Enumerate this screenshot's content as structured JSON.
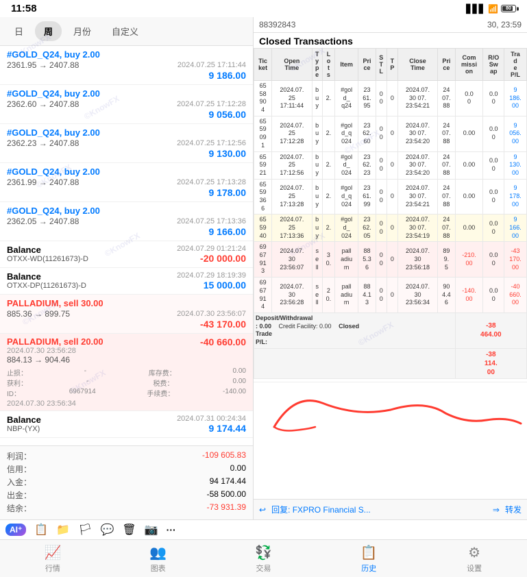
{
  "statusBar": {
    "time": "11:58",
    "battery": "80"
  },
  "leftPanel": {
    "tabs": [
      {
        "label": "日",
        "active": false
      },
      {
        "label": "周",
        "active": true
      },
      {
        "label": "月份",
        "active": false
      },
      {
        "label": "自定义",
        "active": false
      }
    ],
    "transactions": [
      {
        "id": "tx1",
        "title": "#GOLD_Q24, buy 2.00",
        "titleType": "buy",
        "date": "2024.07.25 17:11:44",
        "priceChange": "2361.95 → 2407.88",
        "amount": "9 186.00",
        "negative": false
      },
      {
        "id": "tx2",
        "title": "#GOLD_Q24, buy 2.00",
        "titleType": "buy",
        "date": "2024.07.25 17:12:28",
        "priceChange": "2362.60 → 2407.88",
        "amount": "9 056.00",
        "negative": false
      },
      {
        "id": "tx3",
        "title": "#GOLD_Q24, buy 2.00",
        "titleType": "buy",
        "date": "2024.07.25 17:12:56",
        "priceChange": "2362.23 → 2407.88",
        "amount": "9 130.00",
        "negative": false
      },
      {
        "id": "tx4",
        "title": "#GOLD_Q24, buy 2.00",
        "titleType": "buy",
        "date": "2024.07.25 17:13:28",
        "priceChange": "2361.99 → 2407.88",
        "amount": "9 178.00",
        "negative": false
      },
      {
        "id": "tx5",
        "title": "#GOLD_Q24, buy 2.00",
        "titleType": "buy",
        "date": "2024.07.25 17:13:36",
        "priceChange": "2362.05 → 2407.88",
        "amount": "9 166.00",
        "negative": false
      },
      {
        "id": "tx6",
        "title": "Balance",
        "titleType": "balance",
        "sub": "OTXX-WD(11261673)-D",
        "date": "2024.07.29 01:21:24",
        "amount": "-20 000.00",
        "negative": true
      },
      {
        "id": "tx7",
        "title": "Balance",
        "titleType": "balance",
        "sub": "OTXX-DP(11261673)-D",
        "date": "2024.07.29 18:19:39",
        "amount": "15 000.00",
        "negative": false,
        "blue": true
      },
      {
        "id": "tx8",
        "title": "PALLADIUM, sell 30.00",
        "titleType": "sell",
        "date": "2024.07.30 23:56:07",
        "priceChange": "885.36 → 899.75",
        "amount": "-43 170.00",
        "negative": true
      },
      {
        "id": "tx9",
        "title": "PALLADIUM, sell 20.00",
        "titleType": "sell",
        "date": "2024.07.30 23:56:28",
        "priceChange": "884.13 → 904.46",
        "amount": "-40 660.00",
        "negative": true,
        "sub2": "2024.07.30 23:56:34"
      }
    ],
    "palladiumDetails": {
      "stopLoss": "-",
      "stockFee": "0.00",
      "profit": "-",
      "tax": "0.00",
      "id": "6967914",
      "continueFee": "-140.00"
    },
    "balanceNBP": {
      "title": "Balance",
      "sub": "NBP-(YX)",
      "date": "2024.07.31 00:24:34",
      "amount": "9 174.44"
    },
    "stats": {
      "profit_label": "利润：",
      "profit_val": "-109 605.83",
      "credit_label": "信用：",
      "credit_val": "0.00",
      "deposit_label": "入金：",
      "deposit_val": "94 174.44",
      "withdraw_label": "出金：",
      "withdraw_val": "-58 500.00",
      "balance_label": "结余：",
      "balance_val": "-73 931.39"
    }
  },
  "rightPanel": {
    "header": "88392843                          30, 23:59",
    "title": "Closed Transactions",
    "tableHeaders": [
      "Tic\nket",
      "Open\nTime",
      "T\ny\np\ne",
      "L\no\nt\ns",
      "Item",
      "Pri\nce",
      "S\nT\nL",
      "T\nP",
      "Close\nTime",
      "Pri\nce",
      "Com\nmissi\non",
      "R/O\nSw\nap",
      "Tra\nd\ne\nP/L"
    ],
    "tableRows": [
      [
        "65\n58\n90\n4",
        "2024.07.\n25\n17:11:44",
        "b\nu\ny",
        "2.",
        "#gol\nd_\nq24",
        "23\n61.\n95\n0",
        "0\n0\n0",
        "0",
        "2024.07.\n30 07.\n23:54:21",
        "24\n07.\n88",
        "0.0\n0",
        "0.0\n0",
        "9\n186.\n00"
      ],
      [
        "65\n59\n09\n1",
        "2024.07.\n25\n17:12:28",
        "b\nu\ny",
        "2.",
        "#gol\nd_q\n024",
        "23\n62.\n60\n0",
        "0\n0\n0",
        "0",
        "2024.07.\n30 07.\n23:54:20",
        "24\n07.\n88",
        "0.00",
        "0.0\n0",
        "9\n056.\n00"
      ],
      [
        "65\n59\n21",
        "2024.07.\n25\n17:12:56",
        "b\nu\ny",
        "2.",
        "#gol\nd_\n024",
        "23\n62.\n23",
        "0\n0\n0",
        "0",
        "2024.07.\n30 07.\n23:54:20",
        "24\n07.\n88",
        "0.00",
        "0.0\n0",
        "9\n130.\n00"
      ],
      [
        "65\n59\n36\n6",
        "2024.07.\n25\n17:13:28",
        "b\nu\ny",
        "2.",
        "#gol\nd_q\n024",
        "23\n61.\n99",
        "0\n0\n0",
        "0",
        "2024.07.\n30 07.\n23:54:21",
        "24\n07.\n88",
        "0.00",
        "0.0\n0",
        "9\n178.\n00"
      ],
      [
        "65\n59\n40",
        "2024.07.\n25\n17:13:36",
        "b\nu\ny",
        "2.",
        "#gol\nd_\n024",
        "23\n62.\n05",
        "0\n0\n0",
        "0",
        "2024.07.\n30 07.\n23:54:19",
        "24\n07.\n88\n0",
        "0.00",
        "0.0\n0",
        "9\n166.\n00"
      ],
      [
        "69\n67\n91\n3",
        "2024.07.\n30\n23:56:07",
        "s\ne\nll",
        "3\n0.",
        "pall\nadiu\nm",
        "88\n5.3\n6\n0\n0",
        "0\n0\n0",
        "0\n0",
        "2024.07.\n30 9.7\n23:56:18",
        "89\n9.\n5",
        "-210.\n00",
        "0.0\n0",
        "-43\n170.\n00"
      ],
      [
        "69\n67\n91\n4",
        "2024.07.\n30\n23:56:28",
        "s\ne\nll",
        "2\n0.",
        "pall\nadiu\nm",
        "88\n4.1\n3\n0\n0",
        "0\n0\n0",
        "0\n0",
        "2024.07.\n30\n23:56:34",
        "90\n4.4\n6",
        "-140.\n00",
        "0.0\n0",
        "-40\n660.\n00"
      ]
    ],
    "bottomRow": {
      "depositLabel": "Deposit/Withdrawal\n: 0.00",
      "creditLabel": "Credit Facility: 0.00",
      "closedLabel": "Closed\nTrade\nP/L:",
      "closedVal": "-38\n464.00"
    },
    "lastRow": [
      "-38\n114.\n00"
    ],
    "replyBar": {
      "replyIcon": "↩",
      "replyText": "回复: FXPRO Financial S...",
      "forwardIcon": "⇒",
      "forwardText": "转发"
    }
  },
  "aiToolbar": {
    "aiLabel": "AI⁺",
    "icons": [
      "📋",
      "🏳",
      "💬",
      "🗑",
      "📷",
      "···"
    ]
  },
  "bottomNav": {
    "items": [
      {
        "icon": "📈",
        "label": "行情",
        "active": false
      },
      {
        "icon": "👥",
        "label": "图表",
        "active": false
      },
      {
        "icon": "💱",
        "label": "交易",
        "active": false
      },
      {
        "icon": "📋",
        "label": "历史",
        "active": true
      },
      {
        "icon": "⚙",
        "label": "设置",
        "active": false
      }
    ]
  }
}
